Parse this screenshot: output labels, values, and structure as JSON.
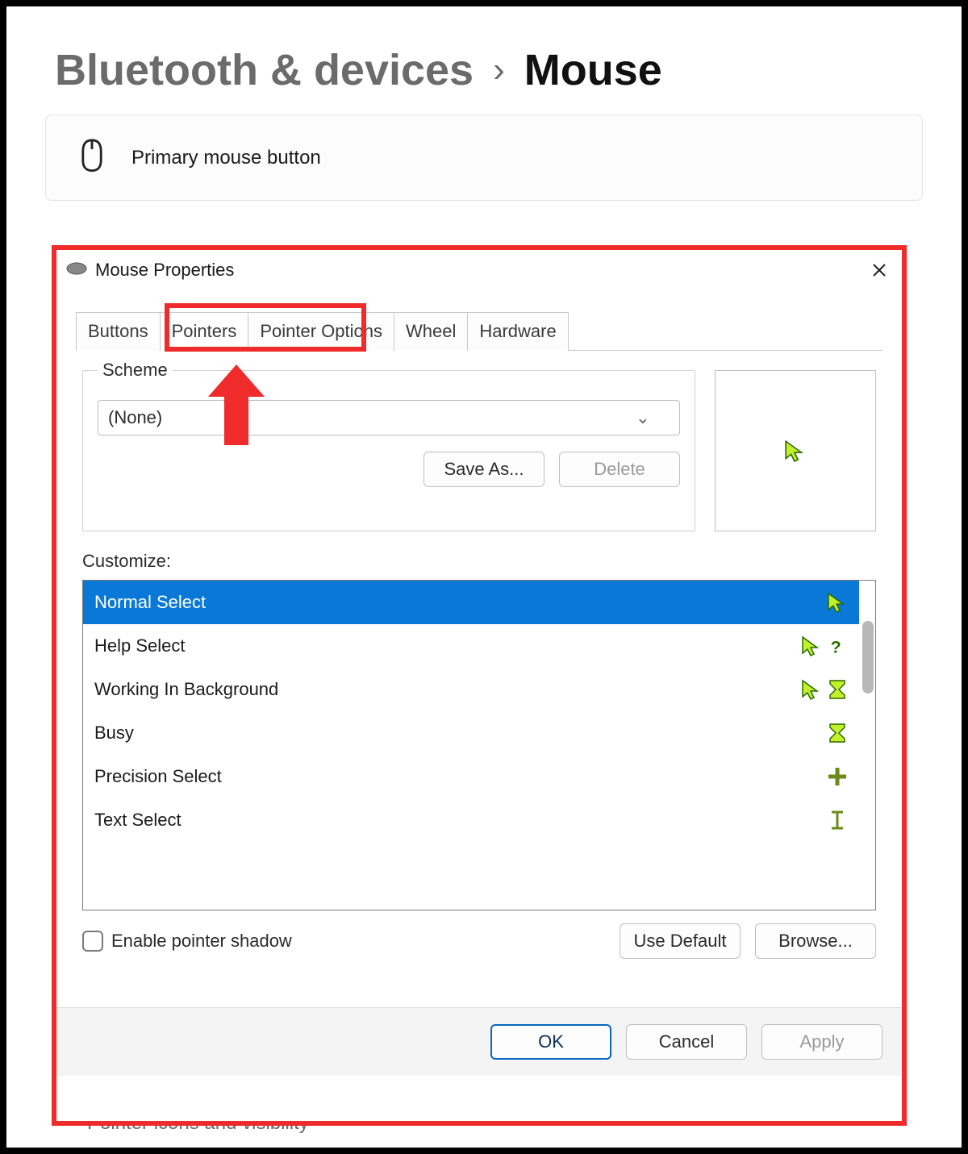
{
  "breadcrumb": {
    "section": "Bluetooth & devices",
    "page": "Mouse"
  },
  "settings": {
    "primary_button_label": "Primary mouse button",
    "pointer_visibility_label": "Pointer icons and visibility"
  },
  "dialog": {
    "title": "Mouse Properties",
    "tabs": [
      "Buttons",
      "Pointers",
      "Pointer Options",
      "Wheel",
      "Hardware"
    ],
    "active_tab_index": 1,
    "scheme": {
      "legend": "Scheme",
      "selected": "(None)",
      "save_as": "Save As...",
      "delete": "Delete"
    },
    "customize_label": "Customize:",
    "cursors": [
      {
        "name": "Normal Select",
        "icon": "arrow"
      },
      {
        "name": "Help Select",
        "icon": "arrow-question"
      },
      {
        "name": "Working In Background",
        "icon": "arrow-hourglass"
      },
      {
        "name": "Busy",
        "icon": "hourglass"
      },
      {
        "name": "Precision Select",
        "icon": "crosshair"
      },
      {
        "name": "Text Select",
        "icon": "ibeam"
      }
    ],
    "selected_cursor_index": 0,
    "pointer_shadow_label": "Enable pointer shadow",
    "use_default": "Use Default",
    "browse": "Browse...",
    "footer": {
      "ok": "OK",
      "cancel": "Cancel",
      "apply": "Apply"
    }
  }
}
